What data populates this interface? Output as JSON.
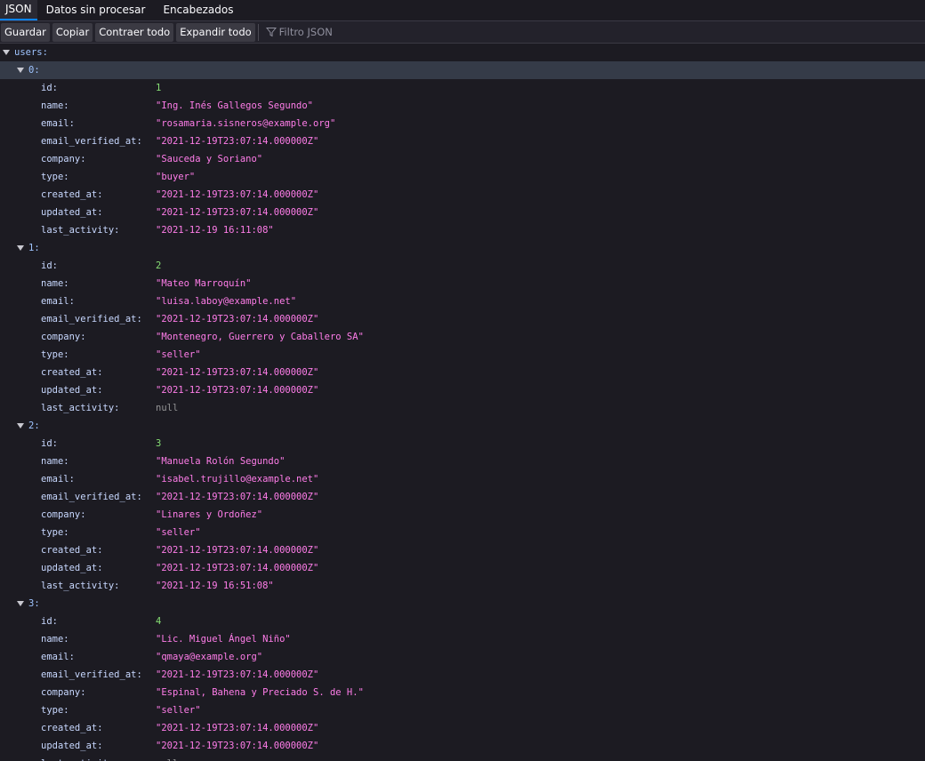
{
  "tabs": [
    {
      "label": "JSON",
      "selected": true
    },
    {
      "label": "Datos sin procesar",
      "selected": false
    },
    {
      "label": "Encabezados",
      "selected": false
    }
  ],
  "toolbar": {
    "save_label": "Guardar",
    "copy_label": "Copiar",
    "collapse_label": "Contraer todo",
    "expand_label": "Expandir todo",
    "filter_placeholder": "Filtro JSON"
  },
  "tree": {
    "root_key": "users:",
    "users": [
      {
        "index": "0:",
        "fields": [
          {
            "key": "id:",
            "value": "1",
            "type": "num"
          },
          {
            "key": "name:",
            "value": "\"Ing. Inés Gallegos Segundo\"",
            "type": "str"
          },
          {
            "key": "email:",
            "value": "\"rosamaria.sisneros@example.org\"",
            "type": "str"
          },
          {
            "key": "email_verified_at:",
            "value": "\"2021-12-19T23:07:14.000000Z\"",
            "type": "str"
          },
          {
            "key": "company:",
            "value": "\"Sauceda y Soriano\"",
            "type": "str"
          },
          {
            "key": "type:",
            "value": "\"buyer\"",
            "type": "str"
          },
          {
            "key": "created_at:",
            "value": "\"2021-12-19T23:07:14.000000Z\"",
            "type": "str"
          },
          {
            "key": "updated_at:",
            "value": "\"2021-12-19T23:07:14.000000Z\"",
            "type": "str"
          },
          {
            "key": "last_activity:",
            "value": "\"2021-12-19 16:11:08\"",
            "type": "str"
          }
        ]
      },
      {
        "index": "1:",
        "fields": [
          {
            "key": "id:",
            "value": "2",
            "type": "num"
          },
          {
            "key": "name:",
            "value": "\"Mateo Marroquín\"",
            "type": "str"
          },
          {
            "key": "email:",
            "value": "\"luisa.laboy@example.net\"",
            "type": "str"
          },
          {
            "key": "email_verified_at:",
            "value": "\"2021-12-19T23:07:14.000000Z\"",
            "type": "str"
          },
          {
            "key": "company:",
            "value": "\"Montenegro, Guerrero y Caballero SA\"",
            "type": "str"
          },
          {
            "key": "type:",
            "value": "\"seller\"",
            "type": "str"
          },
          {
            "key": "created_at:",
            "value": "\"2021-12-19T23:07:14.000000Z\"",
            "type": "str"
          },
          {
            "key": "updated_at:",
            "value": "\"2021-12-19T23:07:14.000000Z\"",
            "type": "str"
          },
          {
            "key": "last_activity:",
            "value": "null",
            "type": "nul"
          }
        ]
      },
      {
        "index": "2:",
        "fields": [
          {
            "key": "id:",
            "value": "3",
            "type": "num"
          },
          {
            "key": "name:",
            "value": "\"Manuela Rolón Segundo\"",
            "type": "str"
          },
          {
            "key": "email:",
            "value": "\"isabel.trujillo@example.net\"",
            "type": "str"
          },
          {
            "key": "email_verified_at:",
            "value": "\"2021-12-19T23:07:14.000000Z\"",
            "type": "str"
          },
          {
            "key": "company:",
            "value": "\"Linares y Ordoñez\"",
            "type": "str"
          },
          {
            "key": "type:",
            "value": "\"seller\"",
            "type": "str"
          },
          {
            "key": "created_at:",
            "value": "\"2021-12-19T23:07:14.000000Z\"",
            "type": "str"
          },
          {
            "key": "updated_at:",
            "value": "\"2021-12-19T23:07:14.000000Z\"",
            "type": "str"
          },
          {
            "key": "last_activity:",
            "value": "\"2021-12-19 16:51:08\"",
            "type": "str"
          }
        ]
      },
      {
        "index": "3:",
        "fields": [
          {
            "key": "id:",
            "value": "4",
            "type": "num"
          },
          {
            "key": "name:",
            "value": "\"Lic. Miguel Ángel Niño\"",
            "type": "str"
          },
          {
            "key": "email:",
            "value": "\"qmaya@example.org\"",
            "type": "str"
          },
          {
            "key": "email_verified_at:",
            "value": "\"2021-12-19T23:07:14.000000Z\"",
            "type": "str"
          },
          {
            "key": "company:",
            "value": "\"Espinal, Bahena y Preciado S. de H.\"",
            "type": "str"
          },
          {
            "key": "type:",
            "value": "\"seller\"",
            "type": "str"
          },
          {
            "key": "created_at:",
            "value": "\"2021-12-19T23:07:14.000000Z\"",
            "type": "str"
          },
          {
            "key": "updated_at:",
            "value": "\"2021-12-19T23:07:14.000000Z\"",
            "type": "str"
          },
          {
            "key": "last_activity:",
            "value": "null",
            "type": "nul"
          }
        ]
      }
    ]
  },
  "colors": {
    "background": "#1c1b22",
    "key": "#9fc4ff",
    "number": "#86de74",
    "string": "#ff7de9",
    "null": "#939395",
    "selected_row": "#353b48",
    "tab_accent": "#0a84ff"
  },
  "icons": {
    "filter": "funnel-icon",
    "expander": "triangle-down-icon"
  }
}
